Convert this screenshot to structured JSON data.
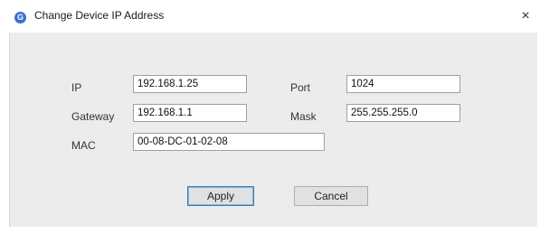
{
  "window": {
    "title": "Change Device IP Address",
    "icon": "app-icon",
    "close_glyph": "×"
  },
  "form": {
    "ip": {
      "label": "IP",
      "value": "192.168.1.25"
    },
    "port": {
      "label": "Port",
      "value": "1024"
    },
    "gateway": {
      "label": "Gateway",
      "value": "192.168.1.1"
    },
    "mask": {
      "label": "Mask",
      "value": "255.255.255.0"
    },
    "mac": {
      "label": "MAC",
      "value": "00-08-DC-01-02-08"
    }
  },
  "buttons": {
    "apply": "Apply",
    "cancel": "Cancel"
  }
}
